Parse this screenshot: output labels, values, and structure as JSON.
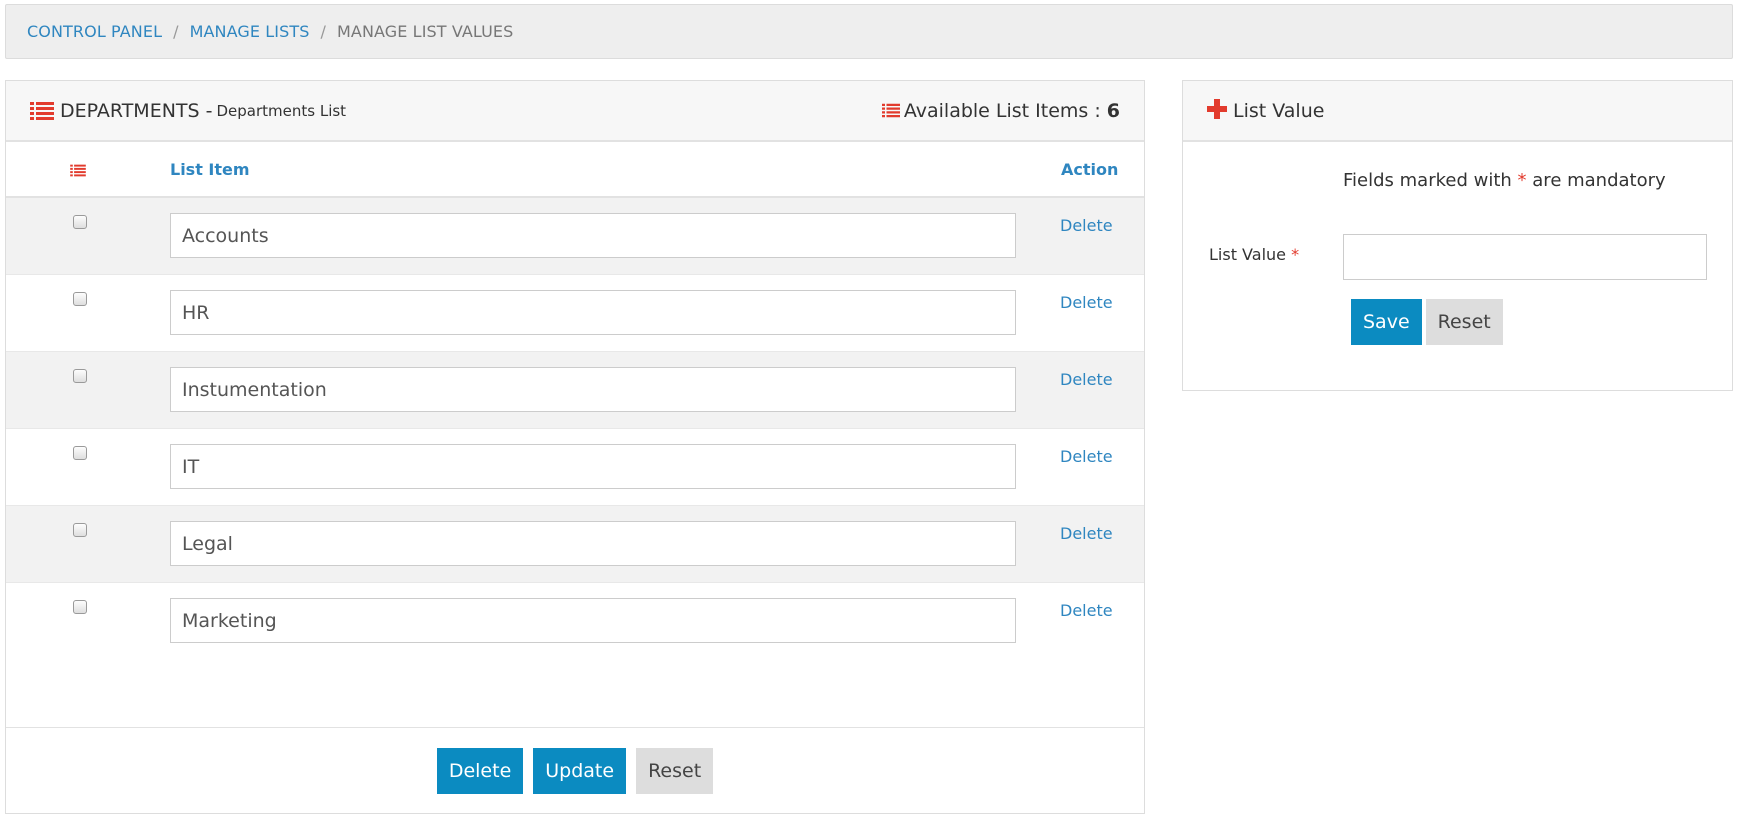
{
  "breadcrumb": {
    "items": [
      "CONTROL PANEL",
      "MANAGE LISTS",
      "MANAGE LIST VALUES"
    ],
    "separator": "/"
  },
  "list_panel": {
    "title": "DEPARTMENTS",
    "title_sep": "-",
    "subtitle": "Departments List",
    "available_label": "Available List Items :",
    "available_count": "6",
    "columns": {
      "item": "List Item",
      "action": "Action"
    },
    "rows": [
      {
        "value": "Accounts",
        "action": "Delete"
      },
      {
        "value": "HR",
        "action": "Delete"
      },
      {
        "value": "Instumentation",
        "action": "Delete"
      },
      {
        "value": "IT",
        "action": "Delete"
      },
      {
        "value": "Legal",
        "action": "Delete"
      },
      {
        "value": "Marketing",
        "action": "Delete"
      }
    ],
    "buttons": {
      "delete": "Delete",
      "update": "Update",
      "reset": "Reset"
    }
  },
  "form_panel": {
    "title": "List Value",
    "mandatory_before": "Fields marked with",
    "mandatory_star": "*",
    "mandatory_after": "are mandatory",
    "field_label": "List Value",
    "field_star": "*",
    "field_value": "",
    "buttons": {
      "save": "Save",
      "reset": "Reset"
    }
  },
  "colors": {
    "accent_red": "#e23b2d",
    "link_blue": "#2f86c0",
    "button_blue": "#0b8bc1"
  },
  "icons": {
    "header_list": "list-icon",
    "available": "list-icon",
    "column": "list-icon",
    "form": "plus-icon"
  }
}
